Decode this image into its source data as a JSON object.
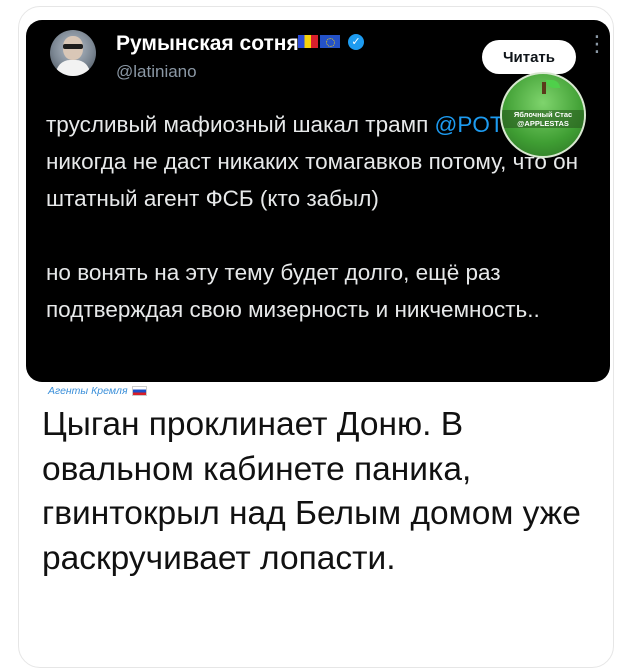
{
  "tweet": {
    "author_name": "Румынская сотня",
    "handle": "@latiniano",
    "follow_label": "Читать",
    "more_label": "⋮",
    "verified_mark": "✓",
    "paragraph1": {
      "before_mention": "трусливый мафиозный шакал трамп ",
      "mention": "@POTUS",
      "after_mention": " никогда не даст никаких томагавков потому, что он штатный агент ФСБ (кто забыл)"
    },
    "paragraph2": "но вонять на эту тему будет долго, ещё раз подтверждая свою мизерность и никчемность.."
  },
  "watermark": {
    "line1": "Яблочный Стас",
    "line2": "@APPLESTAS",
    "colors": {
      "background": "#3f9e33"
    }
  },
  "post": {
    "tag": "Агенты Кремля",
    "caption": "Цыган проклинает Доню. В овальном кабинете паника, гвинтокрыл над Белым домом уже раскручивает лопасти."
  },
  "colors": {
    "tweet_bg": "#000000",
    "mention": "#1d9bf0",
    "handle": "#8b98a5",
    "tag": "#3a8fd9"
  }
}
